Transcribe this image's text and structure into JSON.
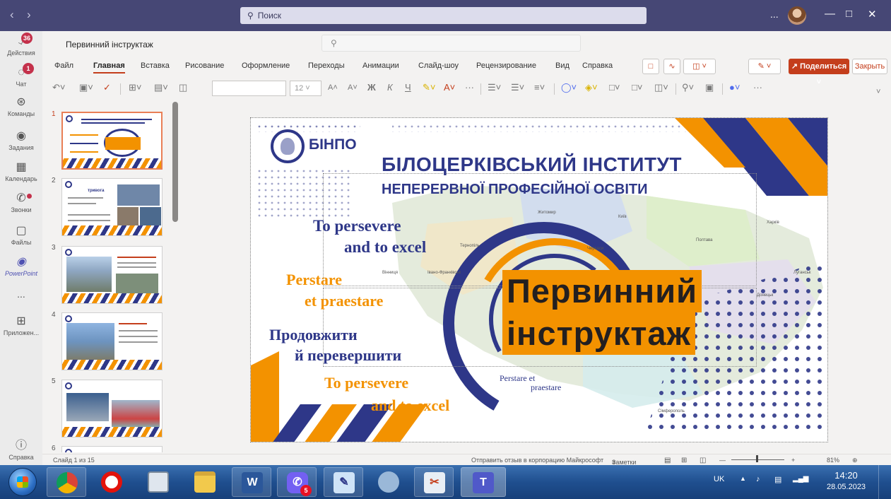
{
  "teams": {
    "search_placeholder": "Поиск",
    "more": "...",
    "rail": [
      {
        "label": "Действия",
        "badge": "36"
      },
      {
        "label": "Чат",
        "badge": "1"
      },
      {
        "label": "Команды"
      },
      {
        "label": "Задания"
      },
      {
        "label": "Календарь"
      },
      {
        "label": "Звонки"
      },
      {
        "label": "Файлы"
      },
      {
        "label": "PowerPoint"
      },
      {
        "label": "..."
      },
      {
        "label": "Приложен..."
      },
      {
        "label": "Справка"
      }
    ]
  },
  "ppt": {
    "doc_title": "Первинний інструктаж",
    "menu": [
      "Файл",
      "Главная",
      "Вставка",
      "Рисование",
      "Оформление",
      "Переходы",
      "Анимации",
      "Слайд-шоу",
      "Рецензирование",
      "Вид",
      "Справка"
    ],
    "active_menu": "Главная",
    "share_label": "Поделиться",
    "close_label": "Закрыть",
    "font_size": "12",
    "toolbar_glyphs": {
      "bold": "Ж",
      "italic": "К",
      "underline": "Ч",
      "grow": "A˄",
      "shrink": "A˅",
      "more": "···"
    },
    "thumb_numbers": [
      "1",
      "2",
      "3",
      "4",
      "5",
      "6"
    ],
    "thumb2_text": "тривога",
    "slide": {
      "bnpo": "БІНПО",
      "inst_line1": "БІЛОЦЕРКІВСЬКИЙ ІНСТИТУТ",
      "inst_line2": "НЕПЕРЕРВНОЇ ПРОФЕСІЙНОЇ ОСВІТИ",
      "motto_en_1a": "To persevere",
      "motto_en_1b": "and to excel",
      "motto_la_a": "Perstare",
      "motto_la_b": "et praestare",
      "motto_ua_a": "Продовжити",
      "motto_ua_b": "й перевершити",
      "motto_en_2a": "To persevere",
      "motto_en_2b": "and to excel",
      "title_line1": "Первинний",
      "title_line2": "інструктаж",
      "small_motto_a": "Perstare et",
      "small_motto_b": "praestare",
      "map_labels": [
        "Житомир",
        "Київ",
        "Харків",
        "Полтава",
        "Черкаси",
        "Тернопіль",
        "Вінниця",
        "Івано-Франківськ",
        "Луганськ",
        "Донецьк",
        "Сімферополь"
      ]
    },
    "status": {
      "slide_of": "Слайд 1 из 15",
      "feedback": "Отправить отзыв в корпорацию Майкрософт",
      "notes": "Заметки",
      "zoom": "81%"
    }
  },
  "taskbar": {
    "lang": "UK",
    "time": "14:20",
    "date": "28.05.2023",
    "viber_badge": "5"
  },
  "colors": {
    "teams_purple": "#464775",
    "ppt_accent": "#c43e1c",
    "brand_blue": "#2e3788",
    "brand_orange": "#f39200"
  }
}
